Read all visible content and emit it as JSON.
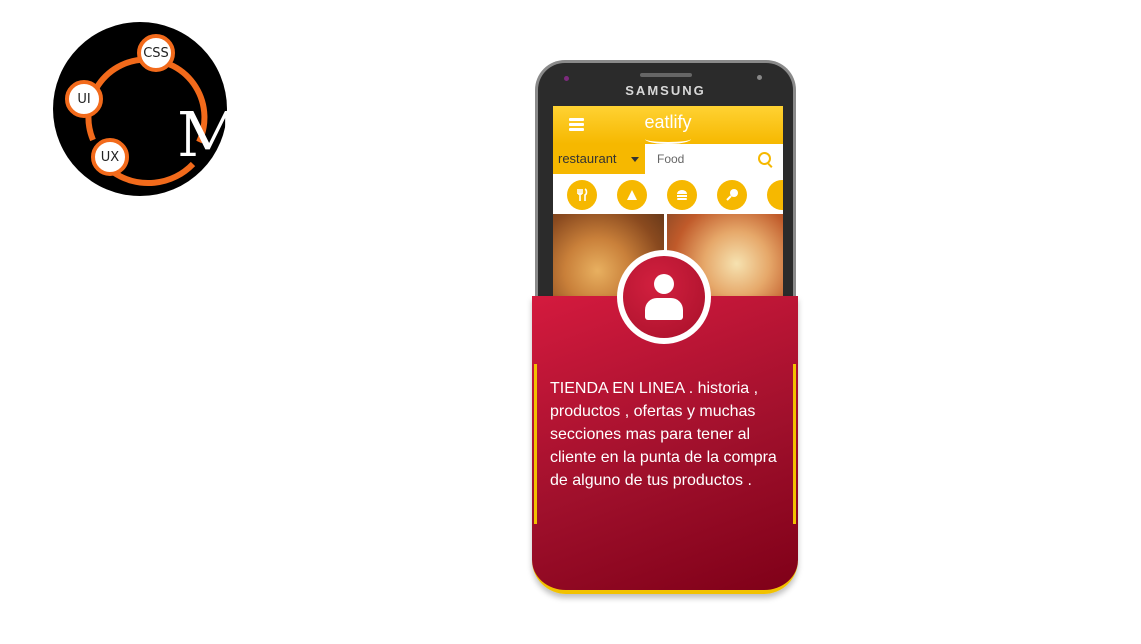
{
  "logo": {
    "letter": "M",
    "badges": [
      "CSS",
      "UI",
      "UX"
    ],
    "accent": "#f26a1b"
  },
  "phone": {
    "brand": "SAMSUNG",
    "app": {
      "title": "eatlify",
      "menu_icon": "hamburger-icon",
      "search": {
        "category": "restaurant",
        "placeholder": "Food",
        "icon": "search-icon"
      },
      "categories": [
        "cutlery-icon",
        "pizza-icon",
        "burger-icon",
        "drumstick-icon",
        "more-icon"
      ],
      "photos": [
        "pizza-photo-1",
        "pizza-photo-2"
      ],
      "accent": "#f6b800"
    }
  },
  "card": {
    "avatar_icon": "user-icon",
    "text": "TIENDA EN LINEA . historia , productos , ofertas y muchas secciones mas para tener al cliente en la punta de la compra de alguno de tus productos .",
    "accent": "#f2c200",
    "background": "#b0102e"
  }
}
